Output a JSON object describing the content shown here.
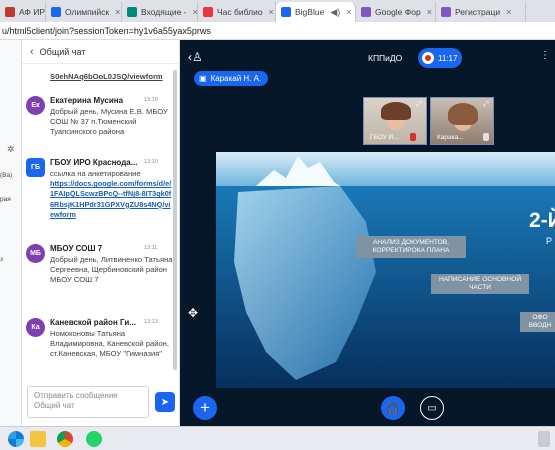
{
  "browser": {
    "tabs": [
      {
        "label": "АФ ИРО",
        "color": "#c0392b",
        "active": false
      },
      {
        "label": "Олимпийск",
        "color": "#1b66f1",
        "active": false
      },
      {
        "label": "Входящие -",
        "color": "#00897b",
        "active": false
      },
      {
        "label": "Час библио",
        "color": "#e53935",
        "active": false
      },
      {
        "label": "BigBlue",
        "color": "#1b66f1",
        "active": true
      },
      {
        "label": "Google Фор",
        "color": "#7e57c2",
        "active": false
      },
      {
        "label": "Регистраци",
        "color": "#7e57c2",
        "active": false
      }
    ],
    "address": "u/html5client/join?sessionToken=hy1v6a55yax5prws"
  },
  "leftstrip": {
    "label_top": "(Ва)",
    "label_mid": "рая",
    "label_low": "з"
  },
  "chat": {
    "title": "Общий чат",
    "top_link": "S0ehNAq6bOoL0JSQ/viewform",
    "messages": [
      {
        "initials": "Ек",
        "color": "#7e3fb0",
        "name": "Екатерина Мусина",
        "time": "13:10",
        "text": "Добрый день, Мусина Е.В. МБОУ СОШ № 37 п.Тюменский Туапсинского района"
      },
      {
        "initials": "ГБ",
        "color": "#1b66f1",
        "name": "ГБОУ ИРО Краснода...",
        "time": "13:10",
        "text": "ссылка на анкетирование",
        "link": "https://docs.google.com/forms/d/e/1FAIpQLScwzBPcQ--tfNj8-8IT3qk0f6RbsjK1HPdr31GPXVgZU8s4NQ/viewform"
      },
      {
        "initials": "МБ",
        "color": "#7e3fb0",
        "name": "МБОУ СОШ 7",
        "time": "13:11",
        "text": "Добрый день, Литвиненко Татьяна Сергеевна, Щербиновский район МБОУ СОШ 7"
      },
      {
        "initials": "Ка",
        "color": "#7e3fb0",
        "name": "Каневской район Ги...",
        "time": "13:13",
        "text": "Номоконовы Татьяна Владимировна, Каневской район, ст.Каневская, МБОУ \"Гимназия\""
      }
    ],
    "composer_placeholder": "Отправить сообщение Общий чат"
  },
  "main": {
    "title": "КППиДО",
    "timer": "11:17",
    "presenter": "Каракай Н. А.",
    "cams": [
      {
        "label": "ГБОУ И..."
      },
      {
        "label": "Карака..."
      }
    ],
    "slide": {
      "boxes": [
        "АНАЛИЗ ДОКУМЕНТОВ, КОРРЕКТИРОКА ПЛАНА",
        "НАПИСАНИЕ ОСНОВНОЙ ЧАСТИ",
        "ОФО ВВОДН"
      ],
      "big": "2-Й",
      "sub": "Р"
    }
  },
  "colors": {
    "accent": "#1b66f1",
    "stage": "#06172a",
    "record": "#d93025"
  }
}
